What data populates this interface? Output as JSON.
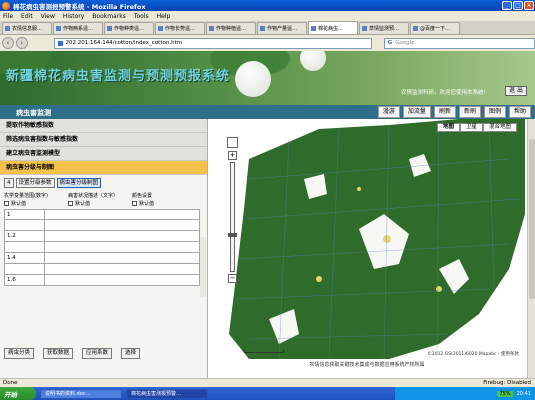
{
  "window": {
    "title": "棉花病虫害测报预警系统 - Mozilla Firefox"
  },
  "menu": [
    "File",
    "Edit",
    "View",
    "History",
    "Bookmarks",
    "Tools",
    "Help"
  ],
  "tabs": [
    {
      "label": "农情信息服…",
      "active": false
    },
    {
      "label": "作物两系遥…",
      "active": false
    },
    {
      "label": "作物种类遥…",
      "active": false
    },
    {
      "label": "作物长势遥…",
      "active": false
    },
    {
      "label": "作物种植遥…",
      "active": false
    },
    {
      "label": "作物产量遥…",
      "active": false
    },
    {
      "label": "棉花病虫…",
      "active": true
    },
    {
      "label": "草情监测预…",
      "active": false
    },
    {
      "label": "@百度一下…",
      "active": false
    }
  ],
  "nav": {
    "url": "202.201.164.144/cotton/index_cotton.htm",
    "search_placeholder": "Google"
  },
  "banner": {
    "title": "新疆棉花病虫害监测与预测预报系统",
    "welcome": "农情监测科研，欢迎您使用本系统！",
    "logout_label": "退 出"
  },
  "subheader": {
    "label": "病虫害监测",
    "buttons": [
      "漫游",
      "加流量",
      "刷新",
      "新刷",
      "图例",
      "帮助"
    ]
  },
  "left_menu": [
    {
      "label": "提取作物敏感指数",
      "selected": false
    },
    {
      "label": "筛选病虫害指数与敏感指数",
      "selected": false
    },
    {
      "label": "建立病虫害监测模型",
      "selected": false
    },
    {
      "label": "病虫害分级与制图",
      "selected": true
    }
  ],
  "tools": {
    "count": "4",
    "setup_label": "设置分级参数",
    "draw_label": "病虫害分级制图"
  },
  "params": {
    "col1_header": "农学变量范围(数字)",
    "col2_header": "病害状况描述（文字）",
    "col3_header": "颜色设置",
    "default_label": "默认值"
  },
  "grid_rows": [
    {
      "value": "1"
    },
    {
      "value": "1.2"
    },
    {
      "value": "1.4"
    },
    {
      "value": "1.6"
    }
  ],
  "bottom_buttons": [
    "病虫分类",
    "获取数据",
    "应用系数",
    "选择"
  ],
  "map": {
    "types": [
      "地图",
      "卫星",
      "混合地图"
    ],
    "active_type": "地图",
    "copyright": "©2012 GS(2011)6020 Mapabc - 使用条款",
    "footer": "农情信息获取关键技术集成与数据应用系统产权所属"
  },
  "status": {
    "left": "Done",
    "right": "Firebug: Disabled"
  },
  "taskbar": {
    "start_label": "开始",
    "tasks": [
      "说明书的资料.doc…",
      "棉花病虫害测报预警…"
    ],
    "battery": "75%",
    "time": "20:41"
  }
}
